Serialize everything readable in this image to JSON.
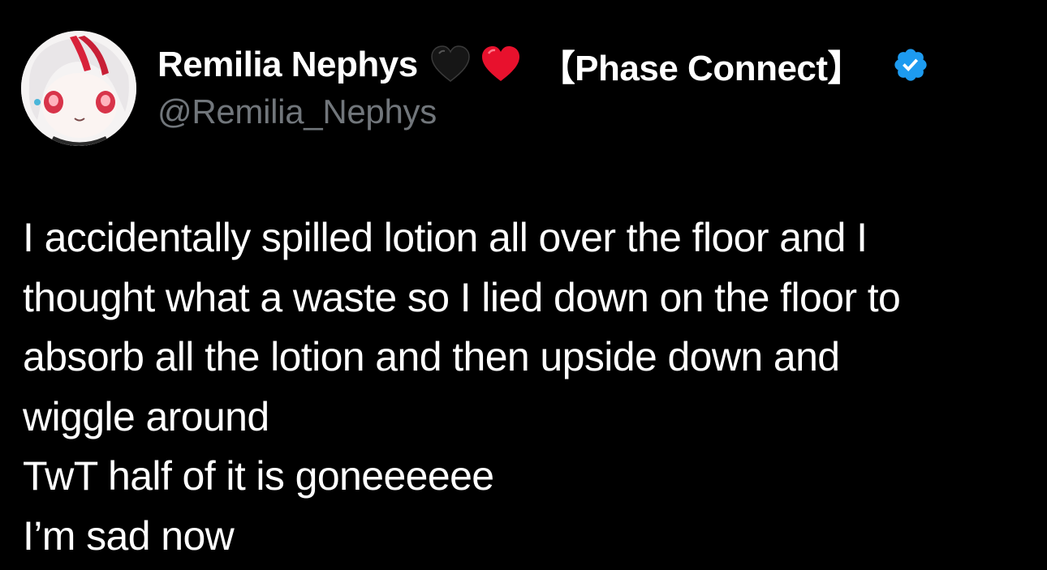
{
  "author": {
    "display_name": "Remilia Nephys",
    "emojis": [
      "black-heart-icon",
      "red-heart-icon"
    ],
    "affiliation": "【Phase Connect】",
    "handle": "@Remilia_Nephys",
    "verified": true,
    "verified_color": "#1d9bf0"
  },
  "tweet": {
    "lines": [
      "I accidentally spilled lotion all over the floor and I",
      "thought what a waste so I lied down on the floor to",
      "absorb all the lotion and then upside down and",
      "wiggle around",
      "TwT half of it is goneeeeee",
      "I’m sad now"
    ]
  },
  "colors": {
    "background": "#000000",
    "text_primary": "#ffffff",
    "text_secondary": "#71767b",
    "heart_red": "#e0245e",
    "heart_black": "#1a1a1a"
  }
}
